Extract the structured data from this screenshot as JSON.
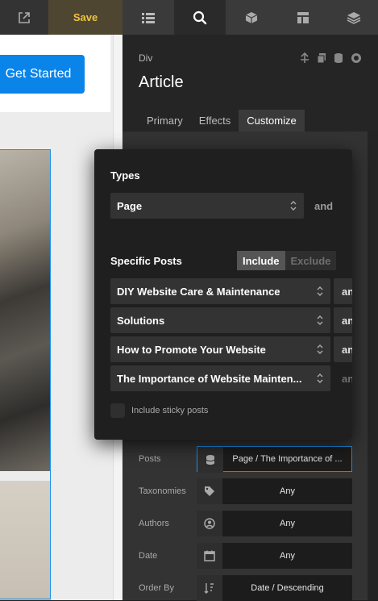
{
  "toolbar": {
    "save_label": "Save",
    "buttons": [
      "open-external",
      "save",
      "structure",
      "search",
      "components",
      "templates",
      "layers"
    ]
  },
  "canvas": {
    "cta_label": "Get Started"
  },
  "panel": {
    "element_type": "Div",
    "element_name": "Article",
    "tabs": [
      {
        "label": "Primary",
        "active": false
      },
      {
        "label": "Effects",
        "active": false
      },
      {
        "label": "Customize",
        "active": true
      }
    ],
    "rows": [
      {
        "label": "Posts",
        "value": "Page / The Importance of ...",
        "icon": "database-icon"
      },
      {
        "label": "Taxonomies",
        "value": "Any",
        "icon": "tag-icon"
      },
      {
        "label": "Authors",
        "value": "Any",
        "icon": "user-circle-icon"
      },
      {
        "label": "Date",
        "value": "Any",
        "icon": "calendar-icon"
      },
      {
        "label": "Order By",
        "value": "Date / Descending",
        "icon": "sort-icon"
      }
    ]
  },
  "popover": {
    "types_heading": "Types",
    "type_value": "Page",
    "and_label": "and",
    "specific_heading": "Specific Posts",
    "include_label": "Include",
    "exclude_label": "Exclude",
    "posts": [
      {
        "title": "DIY Website Care & Maintenance",
        "suffix": "an"
      },
      {
        "title": "Solutions",
        "suffix": "an"
      },
      {
        "title": "How to Promote Your Website",
        "suffix": "an"
      },
      {
        "title": "The Importance of Website Mainten...",
        "suffix": "an"
      }
    ],
    "sticky_label": "Include sticky posts"
  },
  "colors": {
    "accent": "#1a8fe8",
    "save": "#f0c33c",
    "cta": "#0a84e8"
  }
}
